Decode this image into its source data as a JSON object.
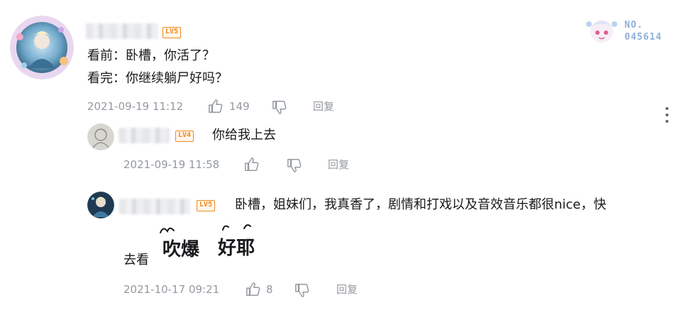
{
  "comment_main": {
    "level": "LV5",
    "lines": [
      "看前：卧槽，你活了？",
      "看完：你继续躺尸好吗？"
    ],
    "date": "2021-09-19 11:12",
    "likes": "149",
    "reply_label": "回复",
    "fan_badge": {
      "line1": "NO.",
      "line2": "045614"
    }
  },
  "reply_1": {
    "level": "LV4",
    "text": "你给我上去",
    "date": "2021-09-19 11:58",
    "reply_label": "回复"
  },
  "reply_2": {
    "level": "LV5",
    "text_line1": "卧槽，姐妹们，我真香了，剧情和打戏以及音效音乐都很nice，快",
    "text_line2": "去看",
    "stickers": [
      "吹爆",
      "好耶"
    ],
    "date": "2021-10-17 09:21",
    "likes": "8",
    "reply_label": "回复"
  },
  "colors": {
    "level_orange": "#f0891a",
    "meta_gray": "#9499a0",
    "text": "#18191c"
  }
}
